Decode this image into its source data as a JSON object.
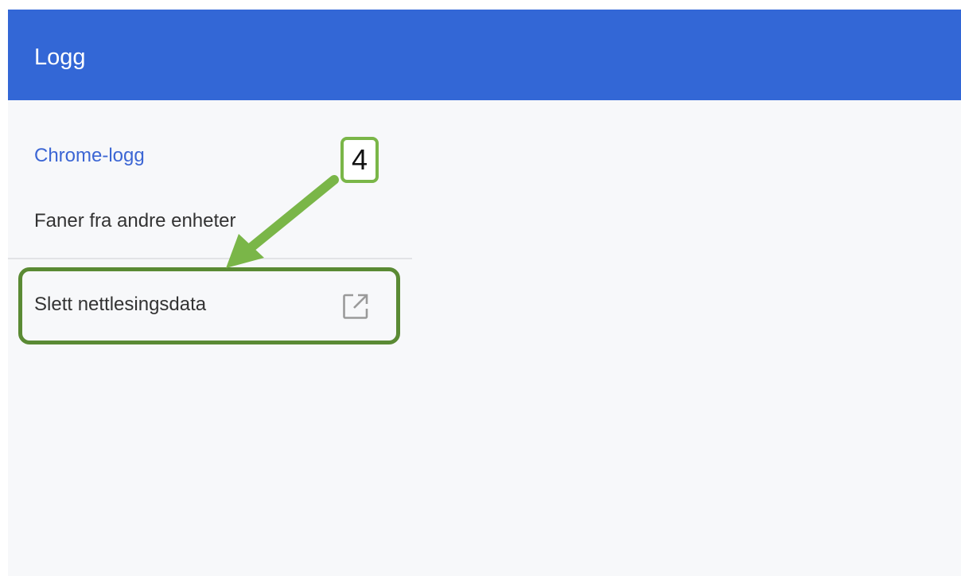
{
  "header": {
    "title": "Logg"
  },
  "sidebar": {
    "items": [
      {
        "label": "Chrome-logg",
        "selected": true
      },
      {
        "label": "Faner fra andre enheter",
        "selected": false
      }
    ],
    "clear_browsing": {
      "label": "Slett nettlesingsdata",
      "icon": "open-in-new-icon"
    }
  },
  "annotation": {
    "step_number": "4",
    "color": "#7ab648",
    "box_color": "#5a8a34"
  },
  "colors": {
    "header_bg": "#3367d6",
    "accent_text": "#3c66d4",
    "page_bg": "#f7f8fa"
  }
}
